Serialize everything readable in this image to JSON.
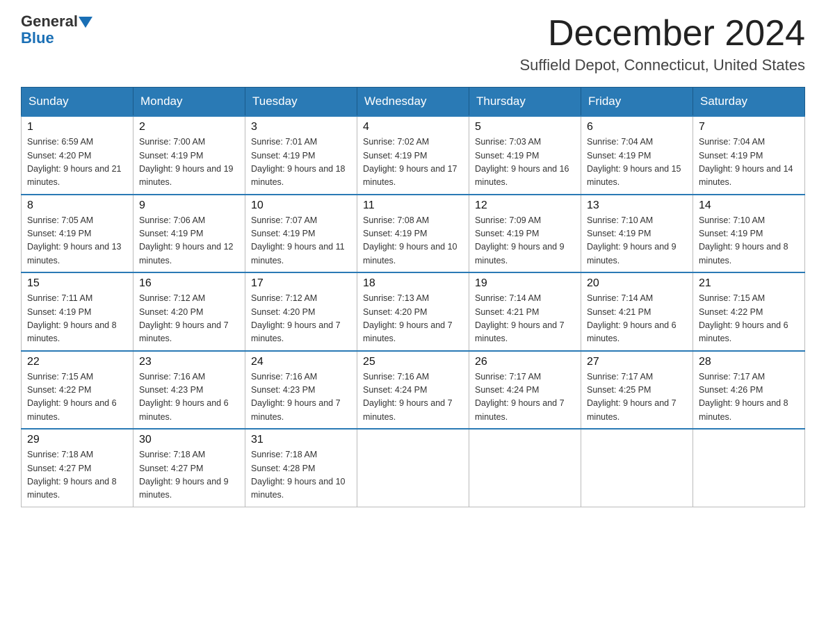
{
  "header": {
    "logo_general": "General",
    "logo_blue": "Blue",
    "month_title": "December 2024",
    "location": "Suffield Depot, Connecticut, United States"
  },
  "days_of_week": [
    "Sunday",
    "Monday",
    "Tuesday",
    "Wednesday",
    "Thursday",
    "Friday",
    "Saturday"
  ],
  "weeks": [
    [
      {
        "day": 1,
        "sunrise": "6:59 AM",
        "sunset": "4:20 PM",
        "daylight": "9 hours and 21 minutes."
      },
      {
        "day": 2,
        "sunrise": "7:00 AM",
        "sunset": "4:19 PM",
        "daylight": "9 hours and 19 minutes."
      },
      {
        "day": 3,
        "sunrise": "7:01 AM",
        "sunset": "4:19 PM",
        "daylight": "9 hours and 18 minutes."
      },
      {
        "day": 4,
        "sunrise": "7:02 AM",
        "sunset": "4:19 PM",
        "daylight": "9 hours and 17 minutes."
      },
      {
        "day": 5,
        "sunrise": "7:03 AM",
        "sunset": "4:19 PM",
        "daylight": "9 hours and 16 minutes."
      },
      {
        "day": 6,
        "sunrise": "7:04 AM",
        "sunset": "4:19 PM",
        "daylight": "9 hours and 15 minutes."
      },
      {
        "day": 7,
        "sunrise": "7:04 AM",
        "sunset": "4:19 PM",
        "daylight": "9 hours and 14 minutes."
      }
    ],
    [
      {
        "day": 8,
        "sunrise": "7:05 AM",
        "sunset": "4:19 PM",
        "daylight": "9 hours and 13 minutes."
      },
      {
        "day": 9,
        "sunrise": "7:06 AM",
        "sunset": "4:19 PM",
        "daylight": "9 hours and 12 minutes."
      },
      {
        "day": 10,
        "sunrise": "7:07 AM",
        "sunset": "4:19 PM",
        "daylight": "9 hours and 11 minutes."
      },
      {
        "day": 11,
        "sunrise": "7:08 AM",
        "sunset": "4:19 PM",
        "daylight": "9 hours and 10 minutes."
      },
      {
        "day": 12,
        "sunrise": "7:09 AM",
        "sunset": "4:19 PM",
        "daylight": "9 hours and 9 minutes."
      },
      {
        "day": 13,
        "sunrise": "7:10 AM",
        "sunset": "4:19 PM",
        "daylight": "9 hours and 9 minutes."
      },
      {
        "day": 14,
        "sunrise": "7:10 AM",
        "sunset": "4:19 PM",
        "daylight": "9 hours and 8 minutes."
      }
    ],
    [
      {
        "day": 15,
        "sunrise": "7:11 AM",
        "sunset": "4:19 PM",
        "daylight": "9 hours and 8 minutes."
      },
      {
        "day": 16,
        "sunrise": "7:12 AM",
        "sunset": "4:20 PM",
        "daylight": "9 hours and 7 minutes."
      },
      {
        "day": 17,
        "sunrise": "7:12 AM",
        "sunset": "4:20 PM",
        "daylight": "9 hours and 7 minutes."
      },
      {
        "day": 18,
        "sunrise": "7:13 AM",
        "sunset": "4:20 PM",
        "daylight": "9 hours and 7 minutes."
      },
      {
        "day": 19,
        "sunrise": "7:14 AM",
        "sunset": "4:21 PM",
        "daylight": "9 hours and 7 minutes."
      },
      {
        "day": 20,
        "sunrise": "7:14 AM",
        "sunset": "4:21 PM",
        "daylight": "9 hours and 6 minutes."
      },
      {
        "day": 21,
        "sunrise": "7:15 AM",
        "sunset": "4:22 PM",
        "daylight": "9 hours and 6 minutes."
      }
    ],
    [
      {
        "day": 22,
        "sunrise": "7:15 AM",
        "sunset": "4:22 PM",
        "daylight": "9 hours and 6 minutes."
      },
      {
        "day": 23,
        "sunrise": "7:16 AM",
        "sunset": "4:23 PM",
        "daylight": "9 hours and 6 minutes."
      },
      {
        "day": 24,
        "sunrise": "7:16 AM",
        "sunset": "4:23 PM",
        "daylight": "9 hours and 7 minutes."
      },
      {
        "day": 25,
        "sunrise": "7:16 AM",
        "sunset": "4:24 PM",
        "daylight": "9 hours and 7 minutes."
      },
      {
        "day": 26,
        "sunrise": "7:17 AM",
        "sunset": "4:24 PM",
        "daylight": "9 hours and 7 minutes."
      },
      {
        "day": 27,
        "sunrise": "7:17 AM",
        "sunset": "4:25 PM",
        "daylight": "9 hours and 7 minutes."
      },
      {
        "day": 28,
        "sunrise": "7:17 AM",
        "sunset": "4:26 PM",
        "daylight": "9 hours and 8 minutes."
      }
    ],
    [
      {
        "day": 29,
        "sunrise": "7:18 AM",
        "sunset": "4:27 PM",
        "daylight": "9 hours and 8 minutes."
      },
      {
        "day": 30,
        "sunrise": "7:18 AM",
        "sunset": "4:27 PM",
        "daylight": "9 hours and 9 minutes."
      },
      {
        "day": 31,
        "sunrise": "7:18 AM",
        "sunset": "4:28 PM",
        "daylight": "9 hours and 10 minutes."
      },
      null,
      null,
      null,
      null
    ]
  ]
}
